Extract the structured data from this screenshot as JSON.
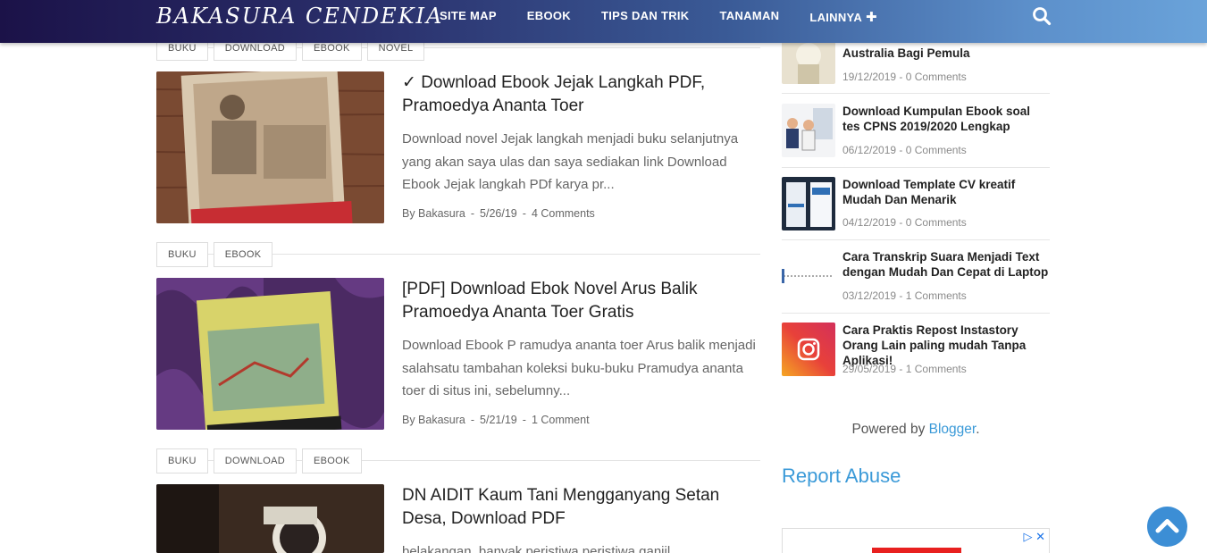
{
  "header": {
    "logo": "BAKASURA CENDEKIA",
    "nav": [
      {
        "label": "SITE MAP"
      },
      {
        "label": "EBOOK"
      },
      {
        "label": "TIPS DAN TRIK"
      },
      {
        "label": "TANAMAN"
      },
      {
        "label": "LAINNYA",
        "icon": "plus-icon"
      }
    ],
    "search_icon": "search-icon"
  },
  "posts": [
    {
      "tags": [
        "BUKU",
        "DOWNLOAD",
        "EBOOK",
        "NOVEL"
      ],
      "title": "✓ Download Ebook Jejak Langkah PDF, Pramoedya Ananta Toer",
      "excerpt": "Download novel Jejak langkah menjadi buku selanjutnya yang akan saya ulas dan saya sediakan link Download Ebook Jejak langkah PDf karya pr...",
      "author": "By Bakasura",
      "date": "5/26/19",
      "comments": "4 Comments"
    },
    {
      "tags": [
        "BUKU",
        "EBOOK"
      ],
      "title": "[PDF] Download Ebok Novel Arus Balik Pramoedya Ananta Toer Gratis",
      "excerpt": "Download Ebook P ramudya ananta toer Arus balik menjadi salahsatu tambahan koleksi buku-buku Pramudya ananta toer di situs ini, sebelumny...",
      "author": "By Bakasura",
      "date": "5/21/19",
      "comments": "1 Comment"
    },
    {
      "tags": [
        "BUKU",
        "DOWNLOAD",
        "EBOOK"
      ],
      "title": "DN AIDIT Kaum Tani Mengganyang Setan Desa, Download PDF",
      "excerpt": "belakangan, banyak peristiwa peristiwa ganjil..."
    }
  ],
  "sidebar": {
    "items": [
      {
        "title": "Australia Bagi Pemula",
        "meta": "19/12/2019 - 0 Comments"
      },
      {
        "title": "Download Kumpulan Ebook soal tes CPNS 2019/2020 Lengkap",
        "meta": "06/12/2019 - 0 Comments"
      },
      {
        "title": "Download Template CV kreatif Mudah Dan Menarik",
        "meta": "04/12/2019 - 0 Comments"
      },
      {
        "title": "Cara Transkrip Suara Menjadi Text dengan Mudah Dan Cepat di Laptop",
        "meta": "03/12/2019 - 1 Comments"
      },
      {
        "title": "Cara Praktis Repost Instastory Orang Lain paling mudah Tanpa Aplikasi!",
        "meta": "29/05/2019 - 1 Comments"
      }
    ],
    "powered_prefix": "Powered by ",
    "powered_link": "Blogger",
    "powered_suffix": ".",
    "report_abuse": "Report Abuse"
  },
  "colors": {
    "accent": "#3b9ad8",
    "scroll_button": "#3c8ed5"
  }
}
